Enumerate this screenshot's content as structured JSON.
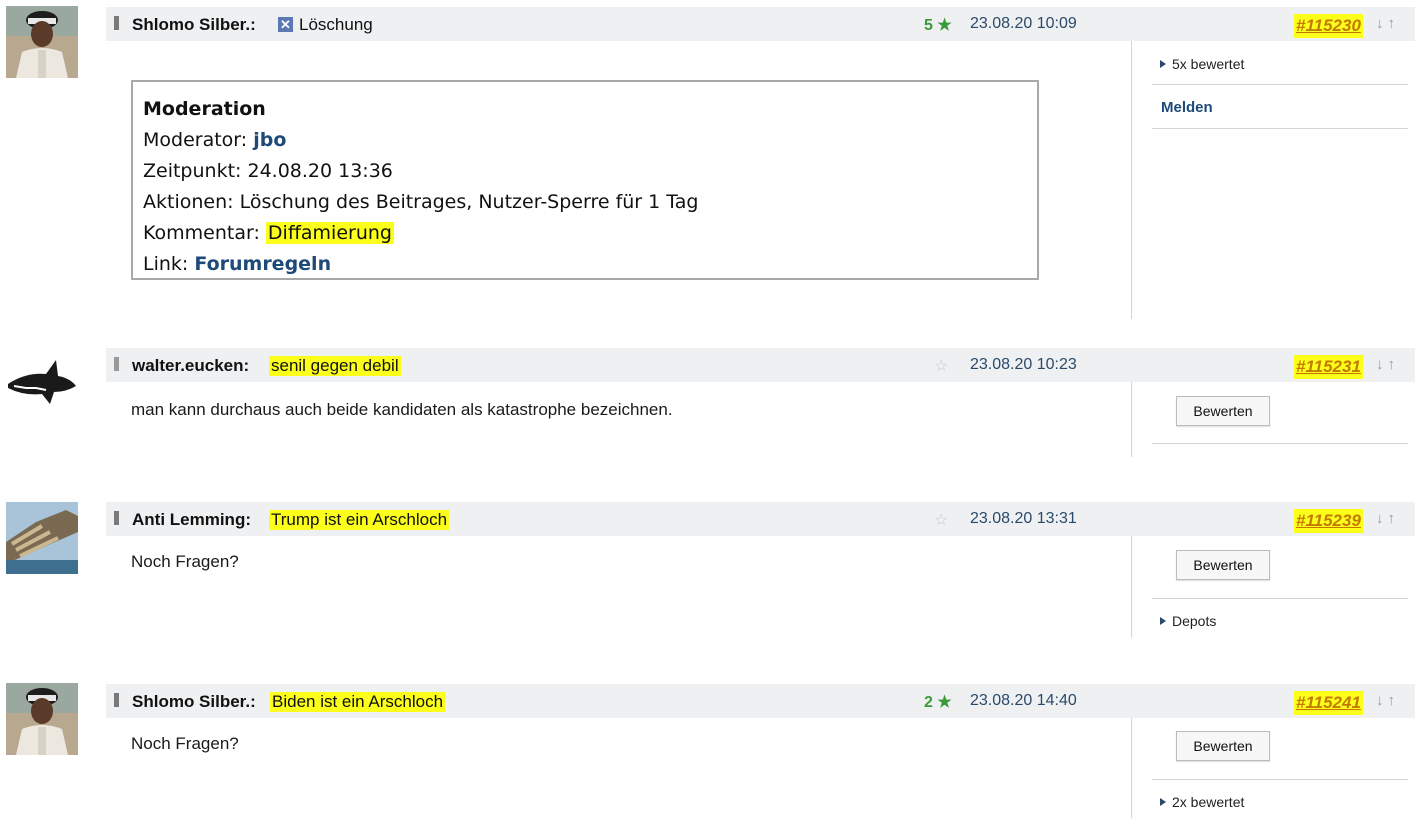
{
  "posts": [
    {
      "author": "Shlomo Silber.:",
      "title": "Löschung",
      "rating": "5",
      "date": "23.08.20 10:09",
      "id": "#115230",
      "sidebar_rated": "5x bewertet",
      "sidebar_report": "Melden",
      "moderation": {
        "heading": "Moderation",
        "moderator_label": "Moderator:",
        "moderator": "jbo",
        "time_label": "Zeitpunkt:",
        "time": "24.08.20 13:36",
        "actions_label": "Aktionen:",
        "actions": "Löschung des Beitrages, Nutzer-Sperre für 1 Tag",
        "comment_label": "Kommentar:",
        "comment": "Diffamierung",
        "link_label": "Link:",
        "link": "Forumregeln"
      }
    },
    {
      "author": "walter.eucken:",
      "title": "senil gegen debil",
      "date": "23.08.20 10:23",
      "id": "#115231",
      "body": "man kann durchaus auch beide kandidaten als katastrophe bezeichnen.",
      "button": "Bewerten"
    },
    {
      "author": "Anti Lemming:",
      "title": "Trump ist ein Arschloch",
      "date": "23.08.20 13:31",
      "id": "#115239",
      "body": "Noch Fragen?",
      "button": "Bewerten",
      "sidebar_depots": "Depots"
    },
    {
      "author": "Shlomo Silber.:",
      "title": "Biden ist ein Arschloch",
      "rating": "2",
      "date": "23.08.20 14:40",
      "id": "#115241",
      "body": "Noch Fragen?",
      "button": "Bewerten",
      "sidebar_rated": "2x bewertet"
    }
  ],
  "icons": {
    "star_filled": "★",
    "star_empty": "☆",
    "arrows": "↓↑",
    "delete": "✕"
  },
  "colors": {
    "highlight": "#fbff1a",
    "rating_green": "#3a9a3a",
    "link_blue": "#1e4a7a",
    "header_bg": "#eef0f2"
  }
}
